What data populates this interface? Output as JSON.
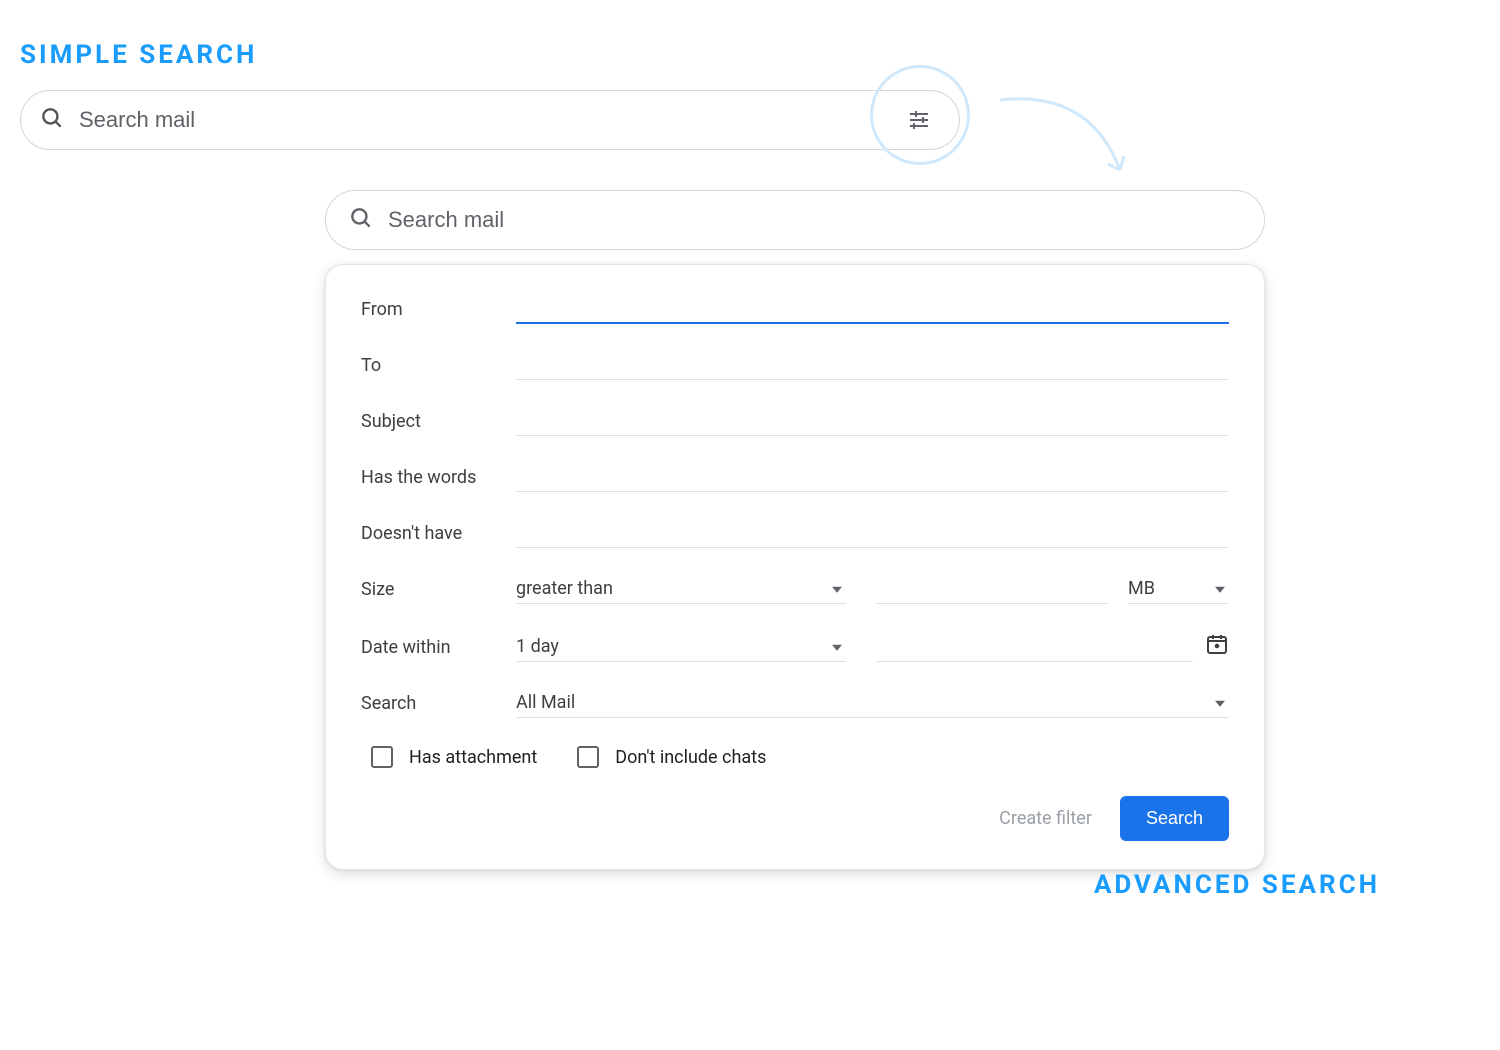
{
  "headings": {
    "simple": "SIMPLE SEARCH",
    "advanced": "ADVANCED SEARCH"
  },
  "simpleSearch": {
    "placeholder": "Search mail"
  },
  "advancedSearch": {
    "placeholder": "Search mail",
    "fields": {
      "from": "From",
      "to": "To",
      "subject": "Subject",
      "hasWords": "Has the words",
      "doesntHave": "Doesn't have",
      "size": "Size",
      "sizeOp": "greater than",
      "sizeUnit": "MB",
      "dateWithin": "Date within",
      "dateRange": "1 day",
      "search": "Search",
      "searchScope": "All Mail"
    },
    "checkboxes": {
      "hasAttachment": "Has attachment",
      "excludeChats": "Don't include chats"
    },
    "actions": {
      "createFilter": "Create filter",
      "search": "Search"
    }
  }
}
